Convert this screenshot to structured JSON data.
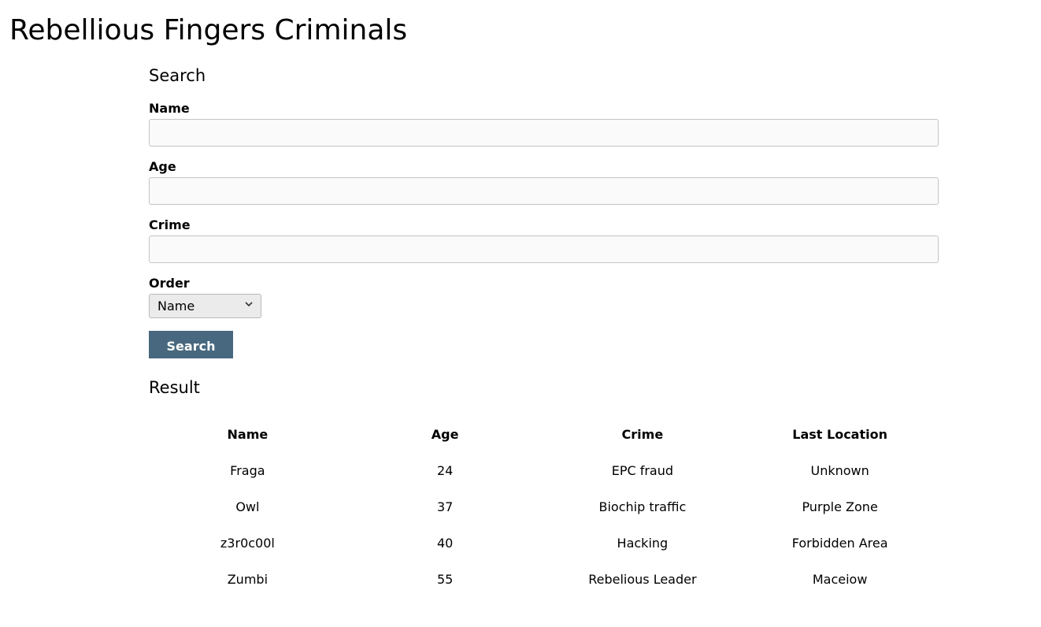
{
  "page": {
    "title": "Rebellious Fingers Criminals"
  },
  "search": {
    "heading": "Search",
    "name_label": "Name",
    "name_value": "",
    "age_label": "Age",
    "age_value": "",
    "crime_label": "Crime",
    "crime_value": "",
    "order_label": "Order",
    "order_selected": "Name",
    "order_icon": "chevron-down-icon",
    "button_label": "Search",
    "button_color": "#47687e"
  },
  "result": {
    "heading": "Result",
    "columns": [
      "Name",
      "Age",
      "Crime",
      "Last Location"
    ],
    "rows": [
      [
        "Fraga",
        "24",
        "EPC fraud",
        "Unknown"
      ],
      [
        "Owl",
        "37",
        "Biochip traffic",
        "Purple Zone"
      ],
      [
        "z3r0c00l",
        "40",
        "Hacking",
        "Forbidden Area"
      ],
      [
        "Zumbi",
        "55",
        "Rebelious Leader",
        "Maceiow"
      ]
    ]
  }
}
